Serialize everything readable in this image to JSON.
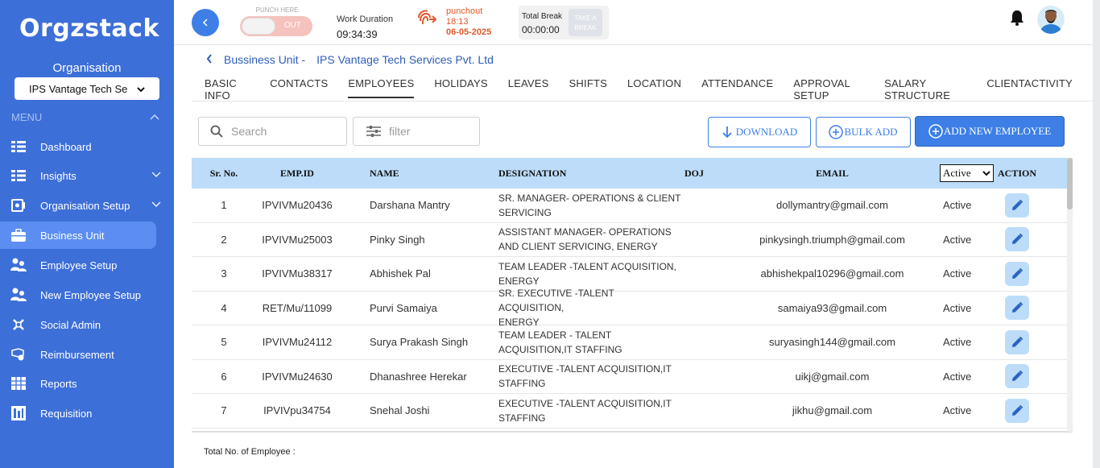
{
  "app": {
    "logo": "Orgzstack"
  },
  "sidebar": {
    "org_label": "Organisation",
    "org_select": "IPS Vantage Tech Se",
    "menu_label": "MENU",
    "items": [
      {
        "label": "Dashboard",
        "icon": "dashboard-icon"
      },
      {
        "label": "Insights",
        "icon": "insights-icon"
      },
      {
        "label": "Organisation Setup",
        "icon": "organisation-setup-icon"
      },
      {
        "label": "Business Unit",
        "icon": "briefcase-icon"
      },
      {
        "label": "Employee Setup",
        "icon": "users-icon"
      },
      {
        "label": "New Employee Setup",
        "icon": "users-icon"
      },
      {
        "label": "Social Admin",
        "icon": "social-icon"
      },
      {
        "label": "Reimbursement",
        "icon": "reimbursement-icon"
      },
      {
        "label": "Reports",
        "icon": "reports-icon"
      },
      {
        "label": "Requisition",
        "icon": "requisition-icon"
      }
    ]
  },
  "topbar": {
    "punch_caption": "PUNCH HERE",
    "punch_toggle": "OUT",
    "work_caption": "Work Duration",
    "work_value": "09:34:39",
    "punchout_label": "punchout",
    "punchout_time": "18:13",
    "punchout_date": "06-05-2025",
    "break_caption": "Total Break",
    "break_value": "00:00:00",
    "take_break_line1": "TAKE A",
    "take_break_line2": "BREAK"
  },
  "breadcrumb": {
    "section": "Bussiness Unit -",
    "unit": "IPS Vantage Tech Services Pvt. Ltd"
  },
  "tabs": [
    "BASIC INFO",
    "CONTACTS",
    "EMPLOYEES",
    "HOLIDAYS",
    "LEAVES",
    "SHIFTS",
    "LOCATION",
    "ATTENDANCE",
    "APPROVAL SETUP",
    "SALARY STRUCTURE",
    "CLIENTACTIVITY"
  ],
  "toolbar": {
    "search_placeholder": "Search",
    "filter_placeholder": "filter",
    "download_label": "DOWNLOAD",
    "bulk_add_label": "BULK ADD",
    "add_new_label": "ADD NEW EMPLOYEE"
  },
  "table": {
    "headers": {
      "sr": "Sr. No.",
      "emp": "EMP.ID",
      "name": "NAME",
      "designation": "DESIGNATION",
      "doj": "DOJ",
      "email": "EMAIL",
      "status_filter": "Active",
      "action": "ACTION"
    },
    "rows": [
      {
        "sr": "1",
        "emp": "IPVIVMu20436",
        "name": "Darshana Mantry",
        "des1": "SR. MANAGER- OPERATIONS & CLIENT",
        "des2": "SERVICING",
        "doj": "",
        "email": "dollymantry@gmail.com",
        "status": "Active"
      },
      {
        "sr": "2",
        "emp": "IPVIVMu25003",
        "name": "Pinky Singh",
        "des1": "ASSISTANT MANAGER- OPERATIONS",
        "des2": "AND CLIENT SERVICING, ENERGY",
        "doj": "",
        "email": "pinkysingh.triumph@gmail.com",
        "status": "Active"
      },
      {
        "sr": "3",
        "emp": "IPVIVMu38317",
        "name": "Abhishek Pal",
        "des1": "TEAM LEADER -TALENT ACQUISITION,",
        "des2": "ENERGY",
        "doj": "",
        "email": "abhishekpal10296@gmail.com",
        "status": "Active"
      },
      {
        "sr": "4",
        "emp": "RET/Mu/11099",
        "name": "Purvi Samaiya",
        "des1": "SR. EXECUTIVE -TALENT ACQUISITION,",
        "des2": "ENERGY",
        "doj": "",
        "email": "samaiya93@gmail.com",
        "status": "Active"
      },
      {
        "sr": "5",
        "emp": "IPVIVMu24112",
        "name": "Surya Prakash Singh",
        "des1": "TEAM LEADER - TALENT",
        "des2": "ACQUISITION,IT STAFFING",
        "doj": "",
        "email": "suryasingh144@gmail.com",
        "status": "Active"
      },
      {
        "sr": "6",
        "emp": "IPVIVMu24630",
        "name": "Dhanashree Herekar",
        "des1": "EXECUTIVE -TALENT ACQUISITION,IT",
        "des2": "STAFFING",
        "doj": "",
        "email": "uikj@gmail.com",
        "status": "Active"
      },
      {
        "sr": "7",
        "emp": "IPVIVpu34754",
        "name": "Snehal Joshi",
        "des1": "EXECUTIVE -TALENT ACQUISITION,IT",
        "des2": "STAFFING",
        "doj": "",
        "email": "jikhu@gmail.com",
        "status": "Active"
      }
    ]
  },
  "footer": {
    "total_label": "Total No. of Employee :"
  },
  "colors": {
    "sidebar": "#3d6fd8",
    "accent": "#3d7fe6",
    "table_header": "#bcdcf9",
    "punchout": "#e0582a"
  }
}
